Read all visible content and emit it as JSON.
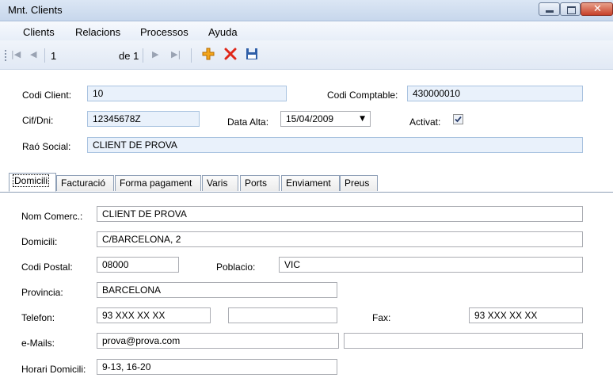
{
  "window": {
    "title": "Mnt. Clients",
    "close_glyph": "✕"
  },
  "menu": [
    "Clients",
    "Relacions",
    "Processos",
    "Ayuda"
  ],
  "toolbar": {
    "position_value": "1",
    "of_label": "de 1",
    "icons": [
      "move-first-icon",
      "move-previous-icon",
      "move-next-icon",
      "move-last-icon",
      "add-icon",
      "delete-icon",
      "save-icon"
    ],
    "colors": {
      "add": "#f2a51c",
      "delete": "#e0281a",
      "save": "#2f5fa8"
    }
  },
  "header_fields": {
    "codi_client": {
      "label": "Codi Client:",
      "value": "10"
    },
    "codi_comptable": {
      "label": "Codi Comptable:",
      "value": "430000010"
    },
    "cif_dni": {
      "label": "Cif/Dni:",
      "value": "12345678Z"
    },
    "data_alta": {
      "label": "Data Alta:",
      "value": "15/04/2009"
    },
    "activat": {
      "label": "Activat:",
      "checked": true
    },
    "rao_social": {
      "label": "Raó Social:",
      "value": "CLIENT DE PROVA"
    }
  },
  "tabs": [
    "Domicili",
    "Facturació",
    "Forma pagament",
    "Varis",
    "Ports",
    "Enviament",
    "Preus"
  ],
  "active_tab": "Domicili",
  "domicili": {
    "nom_comerc": {
      "label": "Nom Comerc.:",
      "value": "CLIENT DE PROVA"
    },
    "domicili": {
      "label": "Domicili:",
      "value": "C/BARCELONA, 2"
    },
    "codi_postal": {
      "label": "Codi Postal:",
      "value": "08000"
    },
    "poblacio": {
      "label": "Poblacio:",
      "value": "VIC"
    },
    "provincia": {
      "label": "Provincia:",
      "value": "BARCELONA"
    },
    "telefon": {
      "label": "Telefon:",
      "value": "93 XXX XX XX",
      "value2": ""
    },
    "fax": {
      "label": "Fax:",
      "value": "93 XXX XX XX"
    },
    "emails": {
      "label": "e-Mails:",
      "value": "prova@prova.com",
      "value2": ""
    },
    "horari": {
      "label": "Horari Domicili:",
      "value": "9-13, 16-20"
    }
  }
}
